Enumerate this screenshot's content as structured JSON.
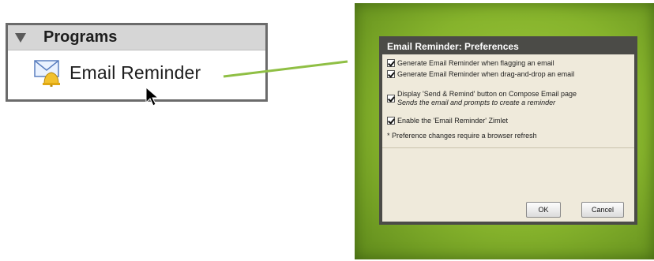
{
  "programs": {
    "header": "Programs",
    "item_label": "Email Reminder"
  },
  "dialog": {
    "title": "Email Reminder: Preferences",
    "options": [
      {
        "label": "Generate Email Reminder when flagging an email",
        "checked": true
      },
      {
        "label": "Generate Email Reminder when drag-and-drop an email",
        "checked": true
      },
      {
        "label": "Display 'Send & Remind' button on Compose Email page",
        "sublabel": "Sends the email and prompts to create a reminder",
        "checked": true
      },
      {
        "label": "Enable the 'Email Reminder' Zimlet",
        "checked": true
      }
    ],
    "note": "* Preference changes require a browser refresh",
    "ok_label": "OK",
    "cancel_label": "Cancel"
  },
  "icons": [
    "collapse-triangle-icon",
    "email-reminder-icon",
    "cursor-icon"
  ],
  "colors": {
    "frame_green": "#86b32c",
    "title_bar": "#4b4b47",
    "dialog_bg": "#efeadb"
  }
}
